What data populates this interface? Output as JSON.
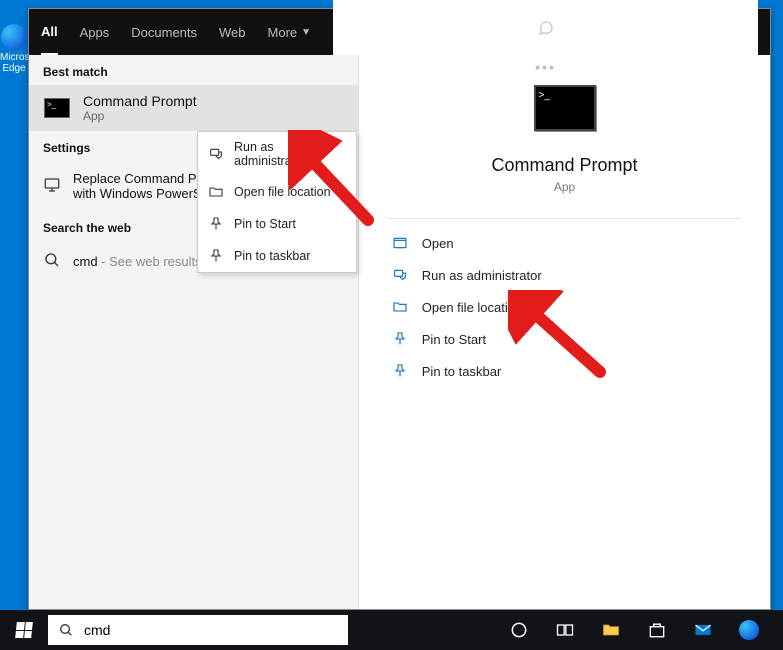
{
  "desktop": {
    "edge_label": "Microsoft Edge"
  },
  "tabs": {
    "all": "All",
    "apps": "Apps",
    "documents": "Documents",
    "web": "Web",
    "more": "More"
  },
  "left": {
    "best_match": "Best match",
    "result_title": "Command Prompt",
    "result_sub": "App",
    "settings_header": "Settings",
    "settings_item": "Replace Command Prompt with Windows PowerShell",
    "search_web_header": "Search the web",
    "web_query": "cmd",
    "web_hint": "- See web results"
  },
  "ctx": {
    "run_admin": "Run as administrator",
    "open_loc": "Open file location",
    "pin_start": "Pin to Start",
    "pin_taskbar": "Pin to taskbar"
  },
  "preview": {
    "title": "Command Prompt",
    "sub": "App",
    "open": "Open",
    "run_admin": "Run as administrator",
    "open_loc": "Open file location",
    "pin_start": "Pin to Start",
    "pin_taskbar": "Pin to taskbar"
  },
  "taskbar": {
    "search_value": "cmd"
  }
}
